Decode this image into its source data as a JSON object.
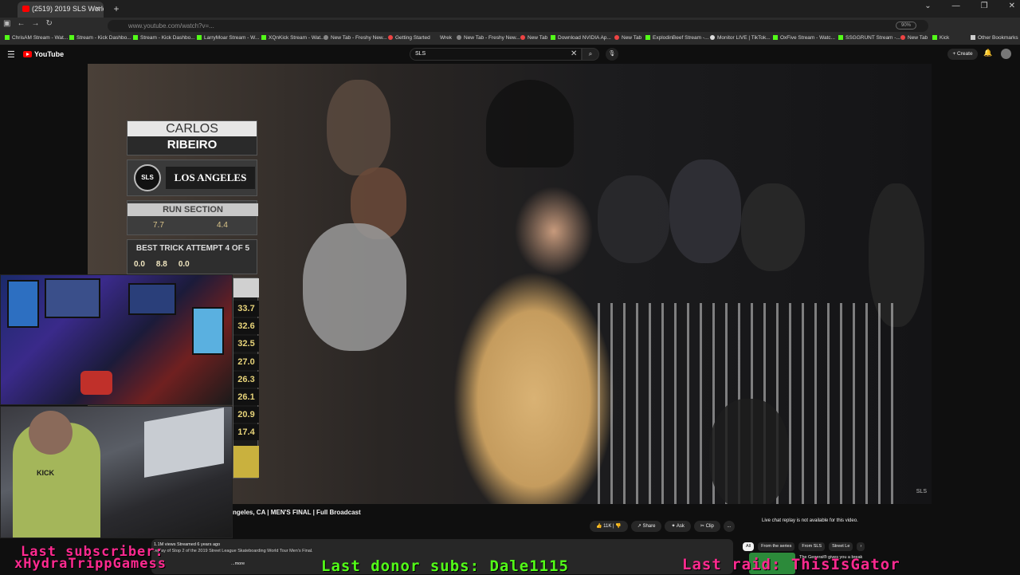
{
  "browser": {
    "tab_title": "(2519) 2019 SLS World Tour",
    "url": "www.youtube.com/watch?v=...",
    "zoom": "90%",
    "bookmarks": [
      "ChrisAM Stream - Wat...",
      "Stream - Kick Dashbo...",
      "Stream - Kick Dashbo...",
      "LarryMoar Stream - W...",
      "XQnKick Stream - Wat...",
      "New Tab - Freshy New...",
      "Getting Started",
      "Wrek",
      "New Tab - Freshy New...",
      "New Tab",
      "Download NVIDIA Ap...",
      "New Tab",
      "ExplodinBeef Stream -...",
      "Monitor LIVE | TikTok...",
      "OxFive Stream - Watc...",
      "SSGGRUNT Stream -...",
      "New Tab",
      "Kick",
      "Other Bookmarks"
    ]
  },
  "youtube": {
    "logo": "YouTube",
    "search_value": "SLS",
    "create_label": "Create"
  },
  "overlay": {
    "first_name": "CARLOS",
    "last_name": "RIBEIRO",
    "badge": "SLS",
    "city": "LOS ANGELES",
    "run_label": "RUN SECTION",
    "run_scores": [
      "7.7",
      "4.4"
    ],
    "best_trick_label": "BEST TRICK ATTEMPT 4 OF 5",
    "best_trick_scores": [
      "0.0",
      "8.8",
      "0.0"
    ],
    "leaderboard": [
      "33.7",
      "32.6",
      "32.5",
      "27.0",
      "26.3",
      "26.1",
      "20.9",
      "17.4"
    ]
  },
  "video": {
    "title": "ngeles, CA | MEN'S FINAL | Full Broadcast",
    "likes": "11K",
    "share": "Share",
    "ask": "Ask",
    "clip": "Clip",
    "more": "...",
    "views": "1.1M views  Streamed 6 years ago",
    "description": "replay of Stop 2 of the 2019 Street League Skateboarding World Tour Men's Final.",
    "desc_more": "...more",
    "chat_notice": "Live chat replay is not available for this video.",
    "filters": [
      "All",
      "From the series",
      "From SLS",
      "Street Le"
    ],
    "rec_title": "The General® gives you a break",
    "corner_logo": "SLS"
  },
  "stream": {
    "last_sub_label": "Last subscriber:",
    "last_sub_name": "xHydraTrippGamess",
    "donor_subs": "Last donor subs: Dale1115",
    "last_raid": "Last raid: ThisIsGator",
    "shirt_text": "KICK"
  }
}
